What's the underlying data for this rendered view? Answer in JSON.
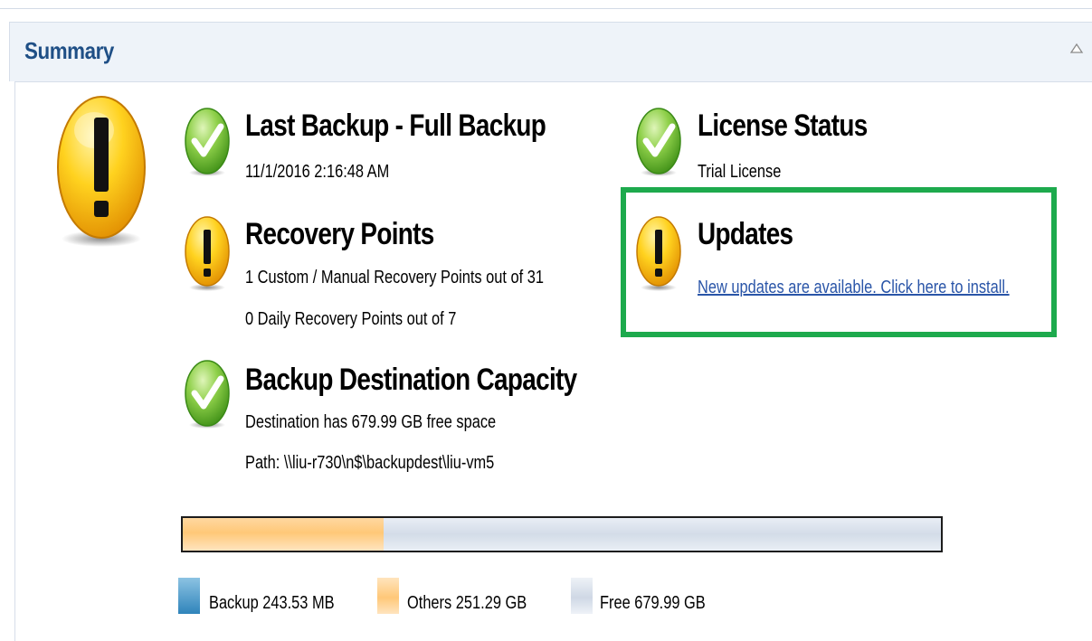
{
  "panel": {
    "title": "Summary",
    "collapse_icon": "collapse-triangle-icon"
  },
  "overall_status": {
    "icon": "warning-icon",
    "state": "warning"
  },
  "last_backup": {
    "status": "ok",
    "title": "Last Backup - Full Backup",
    "timestamp": "11/1/2016 2:16:48 AM"
  },
  "recovery_points": {
    "status": "warning",
    "title": "Recovery Points",
    "line1": "1 Custom / Manual Recovery Points out of 31",
    "line2": "0 Daily Recovery Points out of 7"
  },
  "destination": {
    "status": "ok",
    "title": "Backup Destination Capacity",
    "free_text": "Destination has 679.99 GB free space",
    "path_text": "Path: \\\\liu-r730\\n$\\backupdest\\liu-vm5"
  },
  "license": {
    "status": "ok",
    "title": "License Status",
    "value": "Trial License"
  },
  "updates": {
    "status": "warning",
    "title": "Updates",
    "link_text": "New updates are available. Click here to install."
  },
  "capacity": {
    "backup_fraction": 0.0002,
    "others_fraction": 0.2646,
    "free_fraction": 0.7352,
    "legend": [
      {
        "name": "backup",
        "label": "Backup 243.53 MB",
        "color": "#3b8ec2"
      },
      {
        "name": "others",
        "label": "Others 251.29 GB",
        "color": "#ffc878"
      },
      {
        "name": "free",
        "label": "Free 679.99 GB",
        "color": "#d3dce8"
      }
    ]
  },
  "colors": {
    "title_blue": "#1f4f86",
    "link_blue": "#2a55a8",
    "highlight_green": "#1daa4d",
    "ok_green": "#5fb92f",
    "warn_yellow": "#f5b400"
  }
}
